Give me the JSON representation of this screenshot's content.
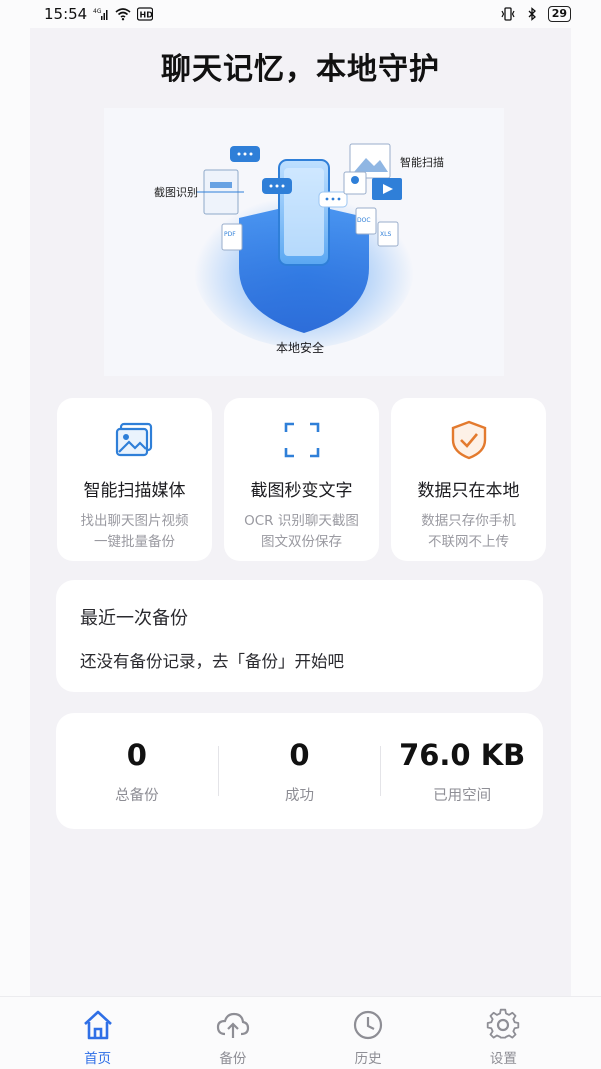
{
  "status_bar": {
    "time": "15:54",
    "network": "4G",
    "battery": "29"
  },
  "title": "聊天记忆，本地守护",
  "hero": {
    "label_screenshot": "截图识别",
    "label_scan": "智能扫描",
    "label_local": "本地安全",
    "doc_pdf": "PDF",
    "doc_doc": "DOC",
    "doc_xls": "XLS"
  },
  "features": [
    {
      "title": "智能扫描媒体",
      "desc_line1": "找出聊天图片视频",
      "desc_line2": "一键批量备份",
      "icon": "image-icon"
    },
    {
      "title": "截图秒变文字",
      "desc_line1": "OCR 识别聊天截图",
      "desc_line2": "图文双份保存",
      "icon": "scan-frame-icon"
    },
    {
      "title": "数据只在本地",
      "desc_line1": "数据只存你手机",
      "desc_line2": "不联网不上传",
      "icon": "shield-check-icon"
    }
  ],
  "recent_backup": {
    "title": "最近一次备份",
    "desc": "还没有备份记录，去「备份」开始吧"
  },
  "stats": [
    {
      "value": "0",
      "label": "总备份"
    },
    {
      "value": "0",
      "label": "成功"
    },
    {
      "value": "76.0 KB",
      "label": "已用空间"
    }
  ],
  "tabs": [
    {
      "label": "首页",
      "icon": "home-icon",
      "active": true
    },
    {
      "label": "备份",
      "icon": "cloud-upload-icon",
      "active": false
    },
    {
      "label": "历史",
      "icon": "clock-icon",
      "active": false
    },
    {
      "label": "设置",
      "icon": "gear-icon",
      "active": false
    }
  ],
  "colors": {
    "accent": "#2f6fe6",
    "icon_blue": "#2f7fd8",
    "shield_orange": "#e37a2e",
    "background": "#f3f2f6",
    "card": "#ffffff",
    "muted_text": "#9a9aa1"
  }
}
